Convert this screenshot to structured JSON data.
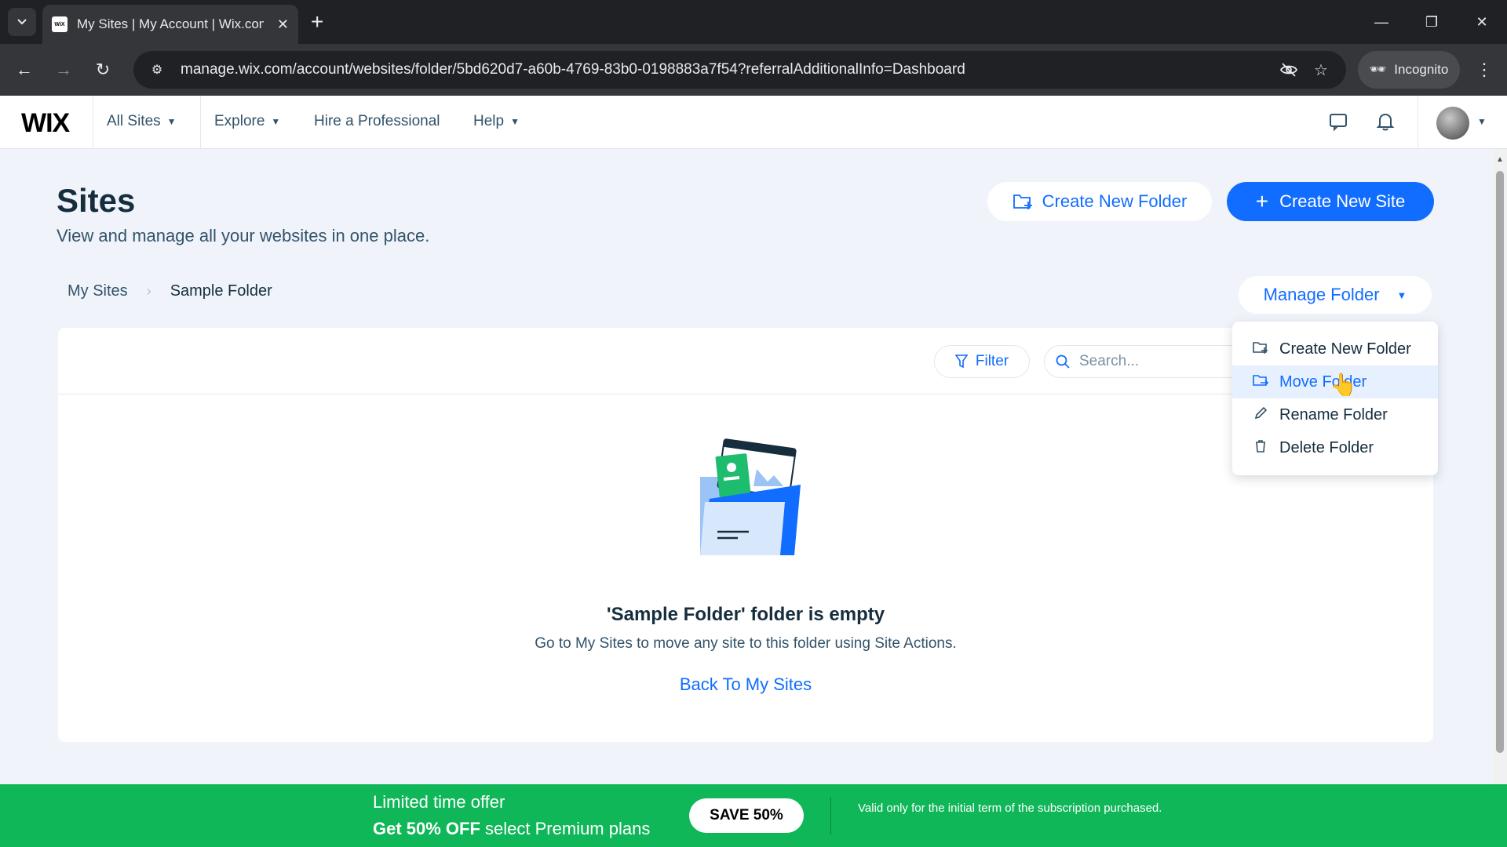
{
  "browser": {
    "tab_title": "My Sites | My Account | Wix.com",
    "favicon_text": "WiX",
    "url": "manage.wix.com/account/websites/folder/5bd620d7-a60b-4769-83b0-0198883a7f54?referralAdditionalInfo=Dashboard",
    "incognito_label": "Incognito"
  },
  "header": {
    "logo": "WIX",
    "nav": [
      {
        "label": "All Sites"
      },
      {
        "label": "Explore"
      },
      {
        "label": "Hire a Professional"
      },
      {
        "label": "Help"
      }
    ]
  },
  "page": {
    "title": "Sites",
    "subtitle": "View and manage all your websites in one place.",
    "create_folder_label": "Create New Folder",
    "create_site_label": "Create New Site"
  },
  "breadcrumb": {
    "root": "My Sites",
    "current": "Sample Folder"
  },
  "manage_folder": {
    "label": "Manage Folder",
    "menu": [
      {
        "label": "Create New Folder",
        "icon": "folder-plus-icon"
      },
      {
        "label": "Move Folder",
        "icon": "folder-move-icon"
      },
      {
        "label": "Rename Folder",
        "icon": "pencil-icon"
      },
      {
        "label": "Delete Folder",
        "icon": "trash-icon"
      }
    ]
  },
  "toolbar": {
    "filter_label": "Filter",
    "search_placeholder": "Search..."
  },
  "empty_state": {
    "title": "'Sample Folder' folder is empty",
    "text": "Go to My Sites to move any site to this folder using Site Actions.",
    "link": "Back To My Sites"
  },
  "promo": {
    "line1": "Limited time offer",
    "line2_bold": "Get 50% OFF",
    "line2_rest": " select Premium plans",
    "button": "SAVE 50%",
    "note": "Valid only for the initial term of the subscription purchased."
  },
  "colors": {
    "accent": "#116dff",
    "promo": "#10b759",
    "text": "#162d3d"
  }
}
